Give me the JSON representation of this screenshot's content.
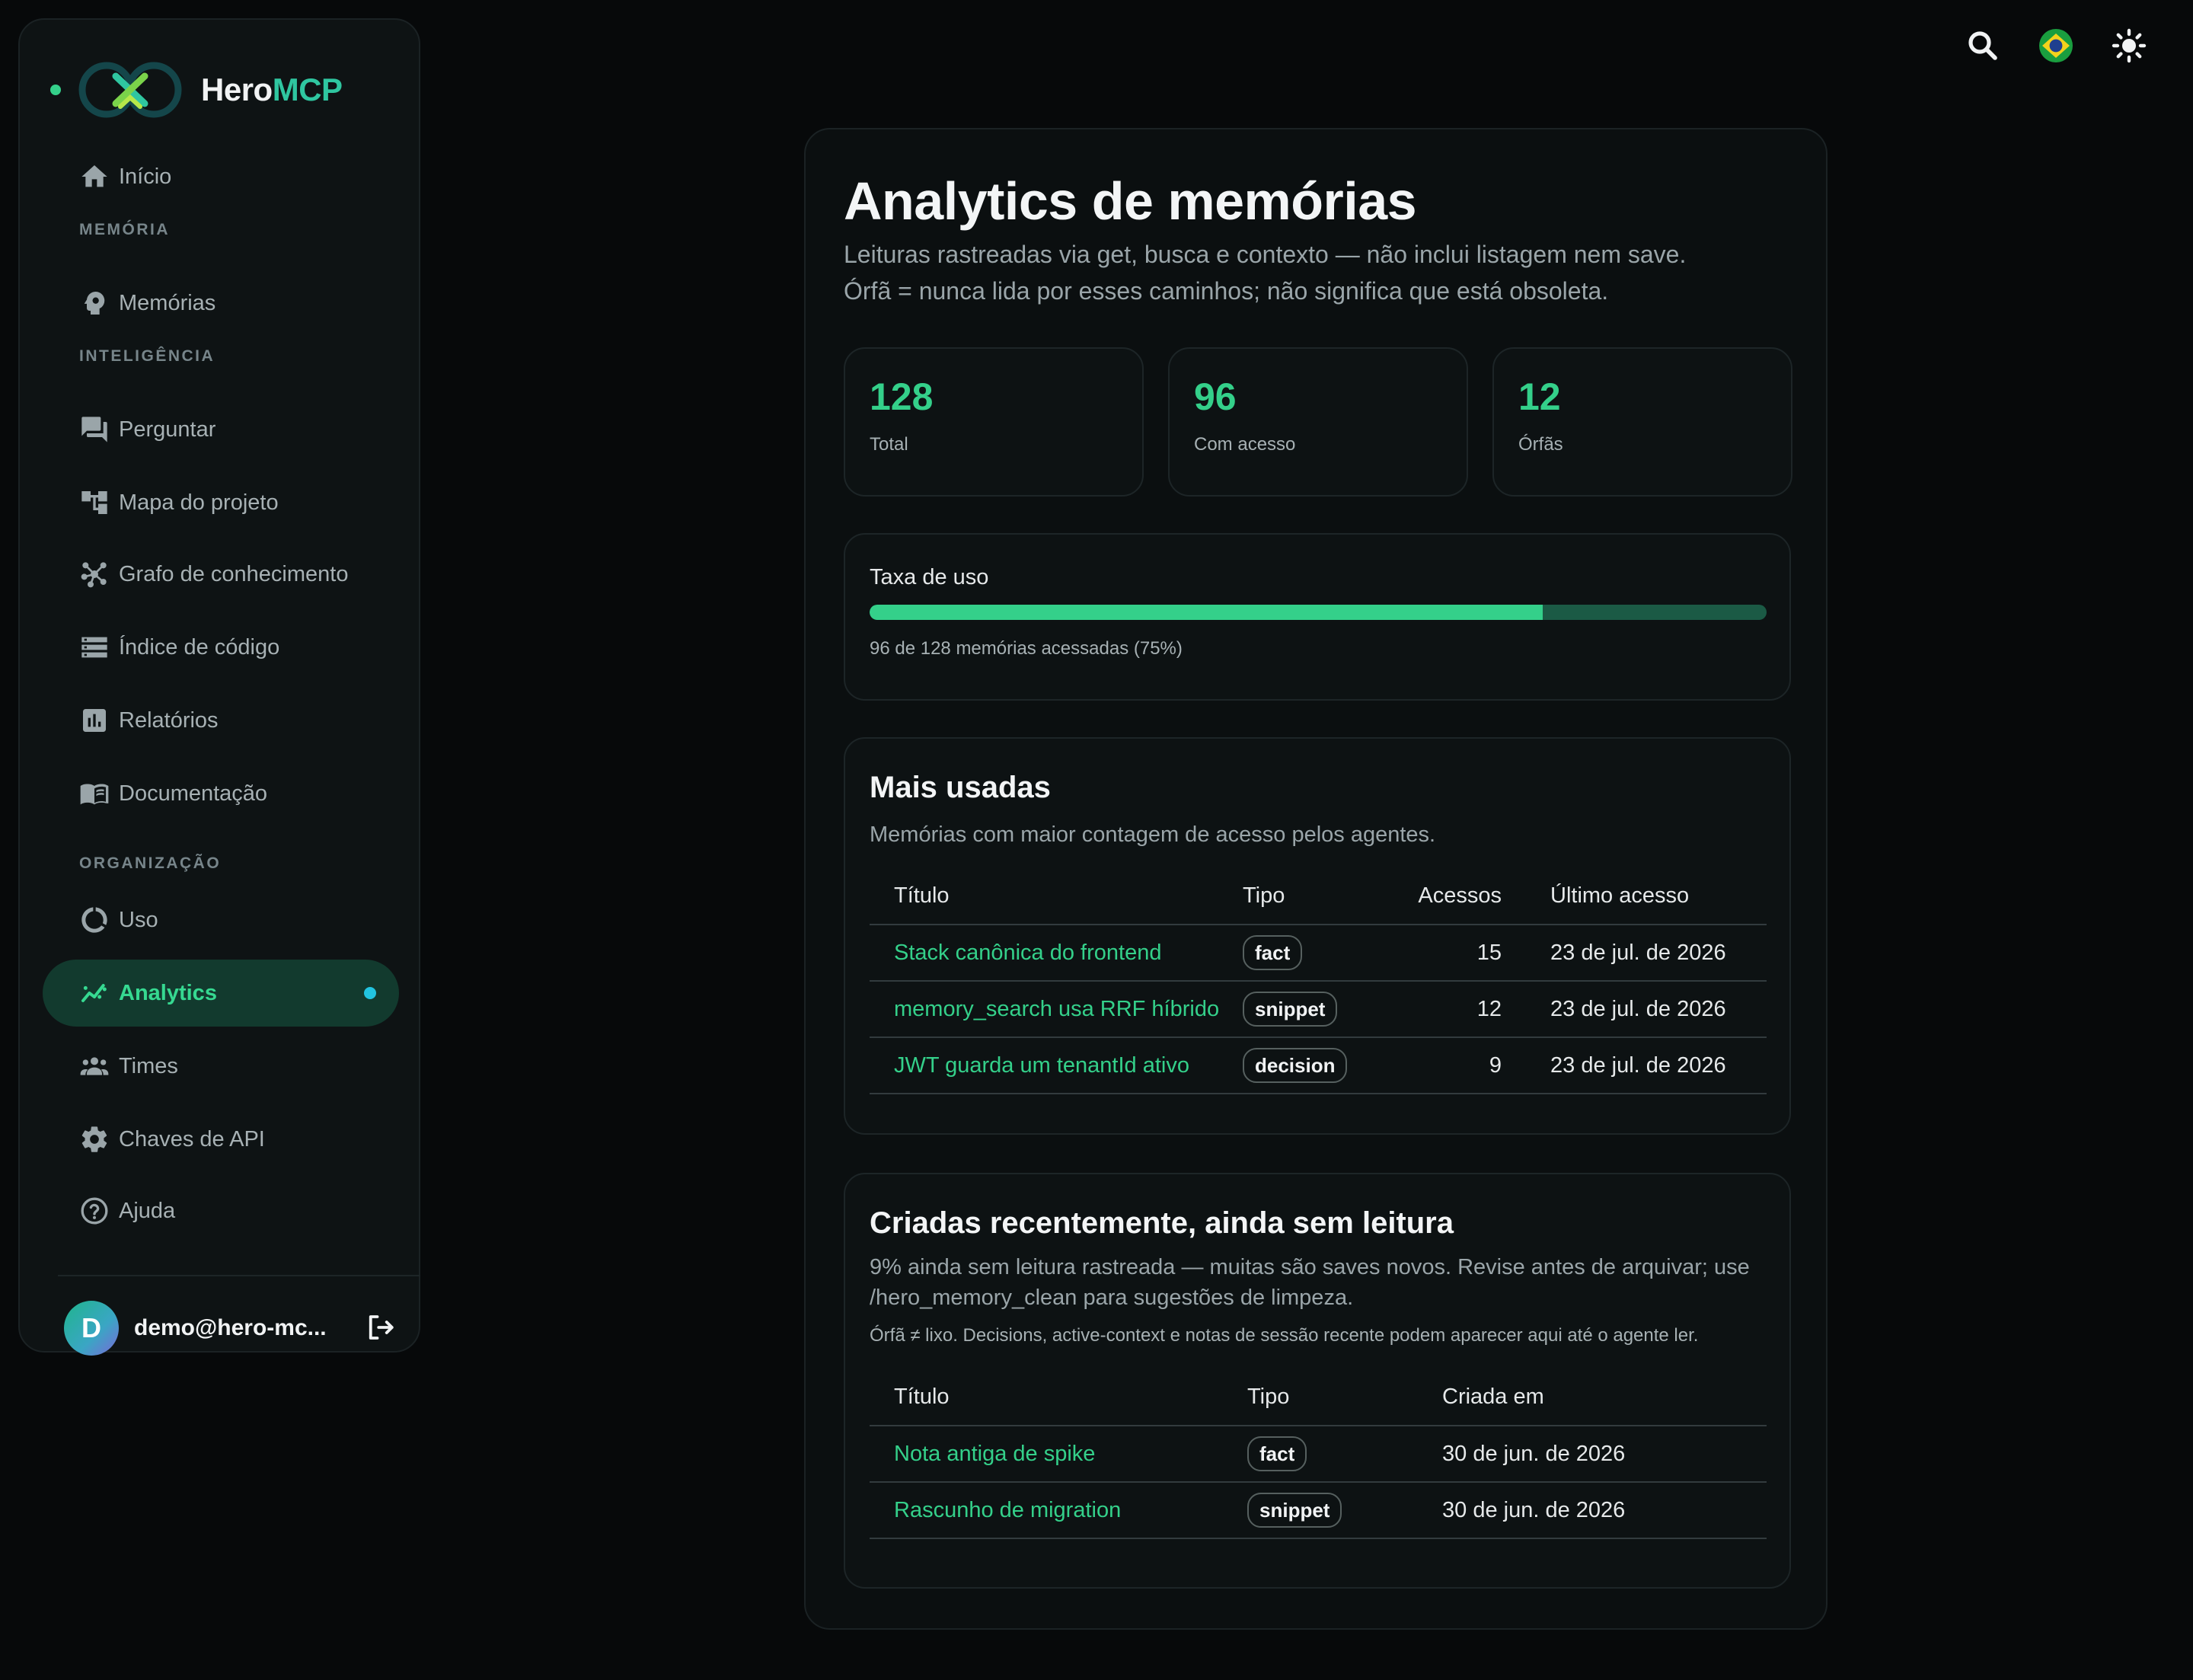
{
  "brand": {
    "name_a": "Hero",
    "name_b": "MCP"
  },
  "nav": {
    "inicio": "Início",
    "sec_memoria": "MEMÓRIA",
    "memorias": "Memórias",
    "sec_inteligencia": "INTELIGÊNCIA",
    "perguntar": "Perguntar",
    "mapa": "Mapa do projeto",
    "grafo": "Grafo de conhecimento",
    "indice": "Índice de código",
    "relatorios": "Relatórios",
    "documentacao": "Documentação",
    "sec_organizacao": "ORGANIZAÇÃO",
    "uso": "Uso",
    "analytics": "Analytics",
    "times": "Times",
    "chaves": "Chaves de API",
    "ajuda": "Ajuda"
  },
  "user": {
    "initial": "D",
    "email": "demo@hero-mc..."
  },
  "page": {
    "title": "Analytics de memórias",
    "subtitle_1": "Leituras rastreadas via get, busca e contexto — não inclui listagem nem save.",
    "subtitle_2": "Órfã = nunca lida por esses caminhos; não significa que está obsoleta."
  },
  "stats": [
    {
      "value": "128",
      "label": "Total"
    },
    {
      "value": "96",
      "label": "Com acesso"
    },
    {
      "value": "12",
      "label": "Órfãs"
    }
  ],
  "usage": {
    "label": "Taxa de uso",
    "fraction": 0.75,
    "text": "96 de 128 memórias acessadas (75%)"
  },
  "most_used": {
    "title": "Mais usadas",
    "desc": "Memórias com maior contagem de acesso pelos agentes.",
    "headers": [
      "Título",
      "Tipo",
      "Acessos",
      "Último acesso"
    ],
    "rows": [
      {
        "title": "Stack canônica do frontend",
        "type": "fact",
        "count": "15",
        "last": "23 de jul. de 2026"
      },
      {
        "title": "memory_search usa RRF híbrido",
        "type": "snippet",
        "count": "12",
        "last": "23 de jul. de 2026"
      },
      {
        "title": "JWT guarda um tenantId ativo",
        "type": "decision",
        "count": "9",
        "last": "23 de jul. de 2026"
      }
    ]
  },
  "recent": {
    "title": "Criadas recentemente, ainda sem leitura",
    "desc_1": "9% ainda sem leitura rastreada — muitas são saves novos. Revise antes de arquivar; use",
    "desc_2": "/hero_memory_clean para sugestões de limpeza.",
    "note": "Órfã ≠ lixo. Decisions, active-context e notas de sessão recente podem aparecer aqui até o agente ler.",
    "headers": [
      "Título",
      "Tipo",
      "Criada em"
    ],
    "rows": [
      {
        "title": "Nota antiga de spike",
        "type": "fact",
        "created": "30 de jun. de 2026"
      },
      {
        "title": "Rascunho de migration",
        "type": "snippet",
        "created": "30 de jun. de 2026"
      }
    ]
  },
  "colors": {
    "accent": "#34d08a",
    "brand_b": "#2fc6a0",
    "active_bg": "#123a2e",
    "active_dot": "#22c4e0"
  }
}
